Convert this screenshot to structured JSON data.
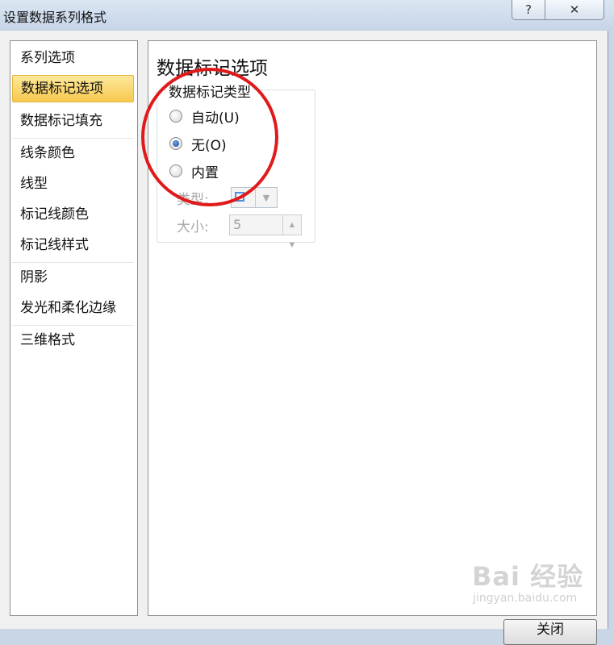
{
  "window": {
    "title": "设置数据系列格式",
    "help_label": "?",
    "close_label": "✕"
  },
  "nav": {
    "items": [
      {
        "label": "系列选项"
      },
      {
        "label": "数据标记选项"
      },
      {
        "label": "数据标记填充"
      },
      {
        "label": "线条颜色"
      },
      {
        "label": "线型"
      },
      {
        "label": "标记线颜色"
      },
      {
        "label": "标记线样式"
      },
      {
        "label": "阴影"
      },
      {
        "label": "发光和柔化边缘"
      },
      {
        "label": "三维格式"
      }
    ],
    "selected_index": 1
  },
  "panel": {
    "title": "数据标记选项",
    "group_label": "数据标记类型",
    "radios": [
      {
        "label": "自动(U)",
        "checked": false
      },
      {
        "label": "无(O)",
        "checked": true
      },
      {
        "label": "内置",
        "checked": false
      }
    ],
    "type_label": "类型:",
    "size_label": "大小:",
    "size_value": "5"
  },
  "footer": {
    "close_button": "关闭"
  },
  "watermark": {
    "text": "Bai 经验",
    "sub": "jingyan.baidu.com"
  },
  "colors": {
    "selected_nav_bg": "#f7c94f",
    "annotation_circle": "#e01a1a"
  }
}
